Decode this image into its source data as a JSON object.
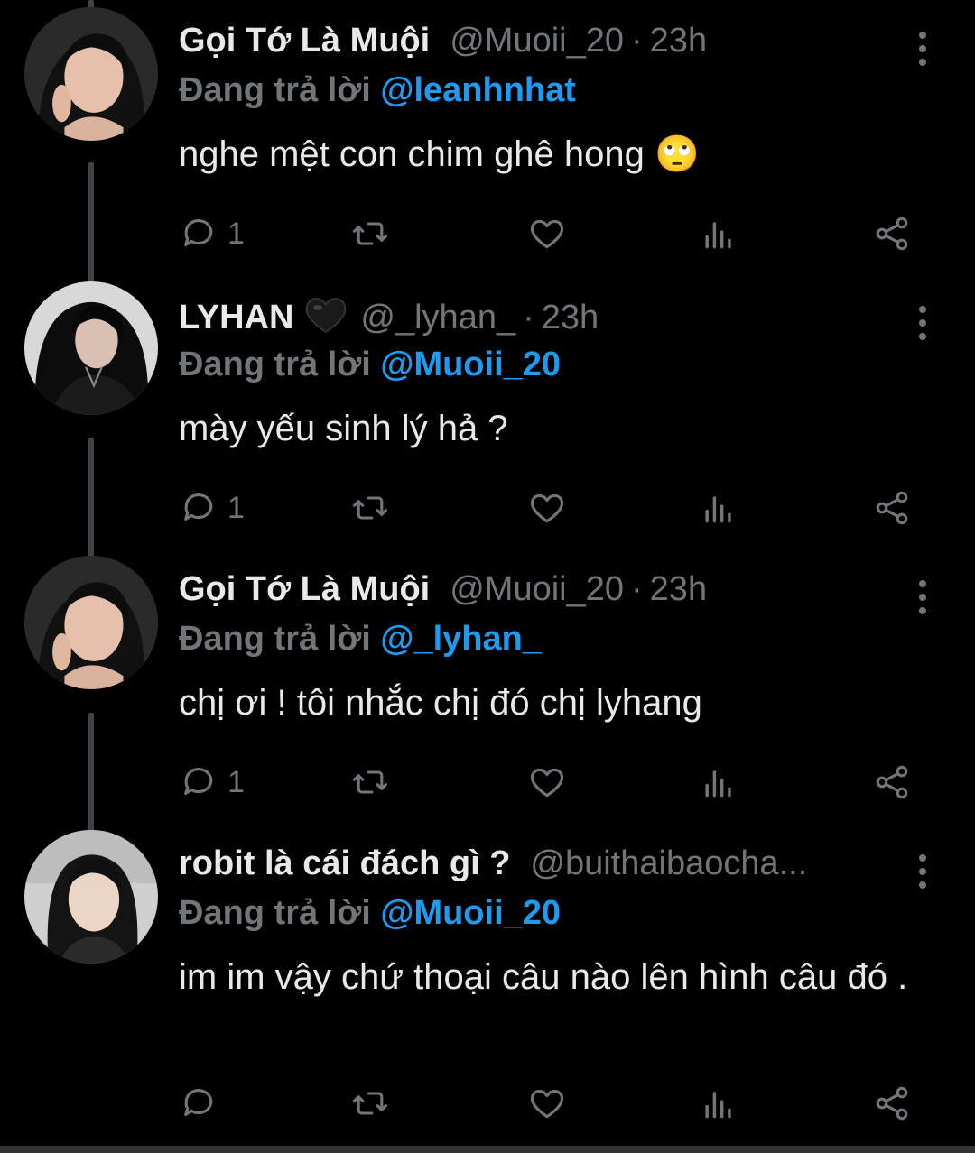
{
  "tweets": [
    {
      "name": "Gọi Tớ Là Muội",
      "handle": "@Muoii_20",
      "dot": "·",
      "time": "23h",
      "reply_prefix": "Đang trả lời",
      "reply_to": "@leanhnhat",
      "text": "nghe mệt con chim ghê hong 🙄",
      "reply_count": "1",
      "avatar": "woman-dark-hair-portrait"
    },
    {
      "name": "LYHAN",
      "handle": "@_lyhan_",
      "dot": "·",
      "time": "23h",
      "reply_prefix": "Đang trả lời",
      "reply_to": "@Muoii_20",
      "text": "mày yếu sinh lý hả ?",
      "reply_count": "1",
      "name_badge": "black-heart-icon",
      "avatar": "woman-long-black-hair-portrait"
    },
    {
      "name": "Gọi Tớ Là Muội",
      "handle": "@Muoii_20",
      "dot": "·",
      "time": "23h",
      "reply_prefix": "Đang trả lời",
      "reply_to": "@_lyhan_",
      "text": "chị ơi ! tôi nhắc chị đó chị lyhang",
      "reply_count": "1",
      "avatar": "woman-dark-hair-portrait"
    },
    {
      "name": "robit là cái đách gì ?",
      "handle": "@buithaibaocha...",
      "dot": "",
      "time": "",
      "reply_prefix": "Đang trả lời",
      "reply_to": "@Muoii_20",
      "text": "im im vậy chứ thoại câu nào lên hình câu đó .",
      "reply_count": "",
      "avatar": "woman-light-background-portrait"
    }
  ],
  "colors": {
    "background": "#000000",
    "text": "#e7e9ea",
    "muted": "#71767b",
    "mention": "#1d9bf0"
  }
}
